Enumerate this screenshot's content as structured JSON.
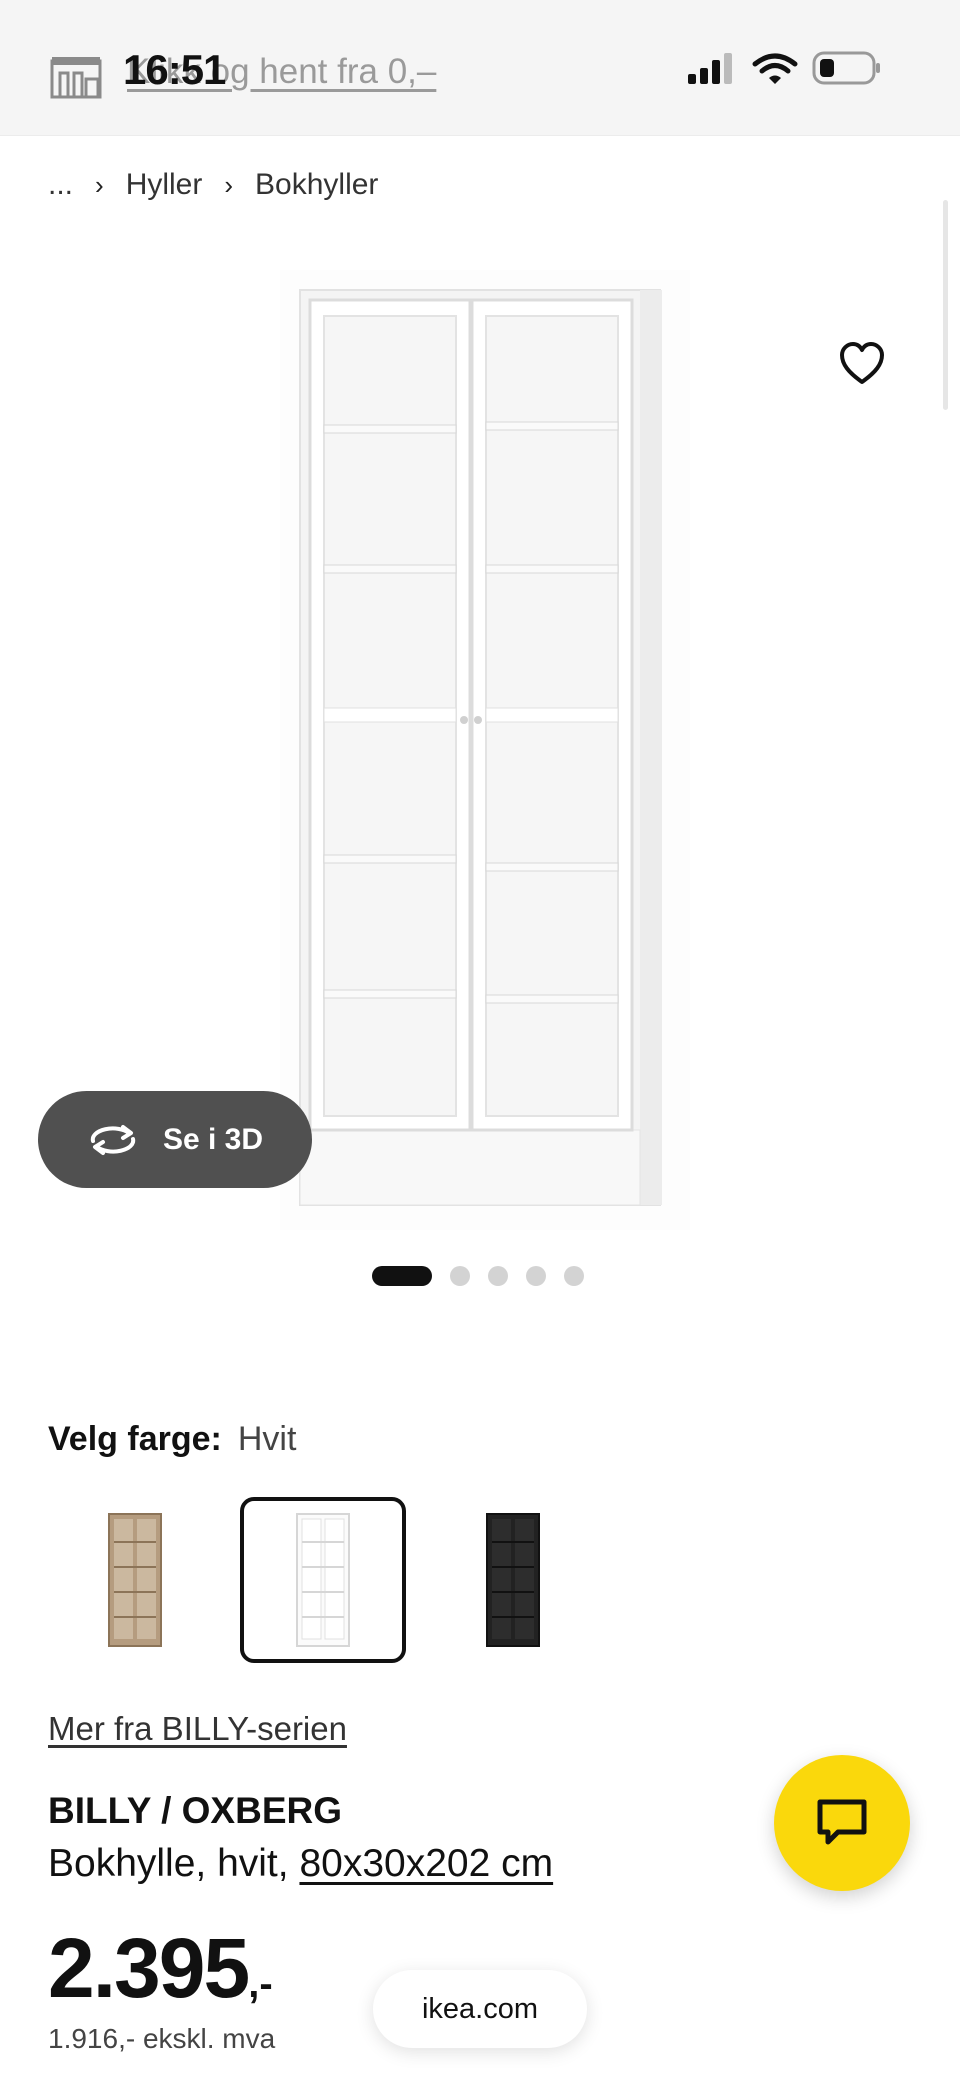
{
  "status_bar": {
    "time": "16:51",
    "store_text": "Klikk og hent fra 0,–"
  },
  "breadcrumb": {
    "items": [
      "...",
      "Hyller",
      "Bokhyller"
    ]
  },
  "gallery": {
    "view_3d_label": "Se i 3D",
    "slide_count": 5,
    "active_slide": 1
  },
  "color_picker": {
    "label": "Velg farge:",
    "selected_value": "Hvit",
    "options": [
      {
        "name": "oak",
        "color": "#a78b6c"
      },
      {
        "name": "white",
        "color": "#ffffff",
        "selected": true
      },
      {
        "name": "black",
        "color": "#222222"
      }
    ]
  },
  "series_link": "Mer fra BILLY-serien",
  "product": {
    "name": "BILLY / OXBERG",
    "description": "Bokhylle, hvit, ",
    "dimensions": "80x30x202 cm"
  },
  "price": {
    "amount": "2.395",
    "suffix": ",-",
    "ex_vat": "1.916,- ekskl. mva"
  },
  "browser": {
    "url": "ikea.com"
  },
  "colors": {
    "chat_button": "#fad80c",
    "btn_3d": "#505050",
    "active_dot": "#111111",
    "inactive_dot": "#d3d3d3"
  }
}
